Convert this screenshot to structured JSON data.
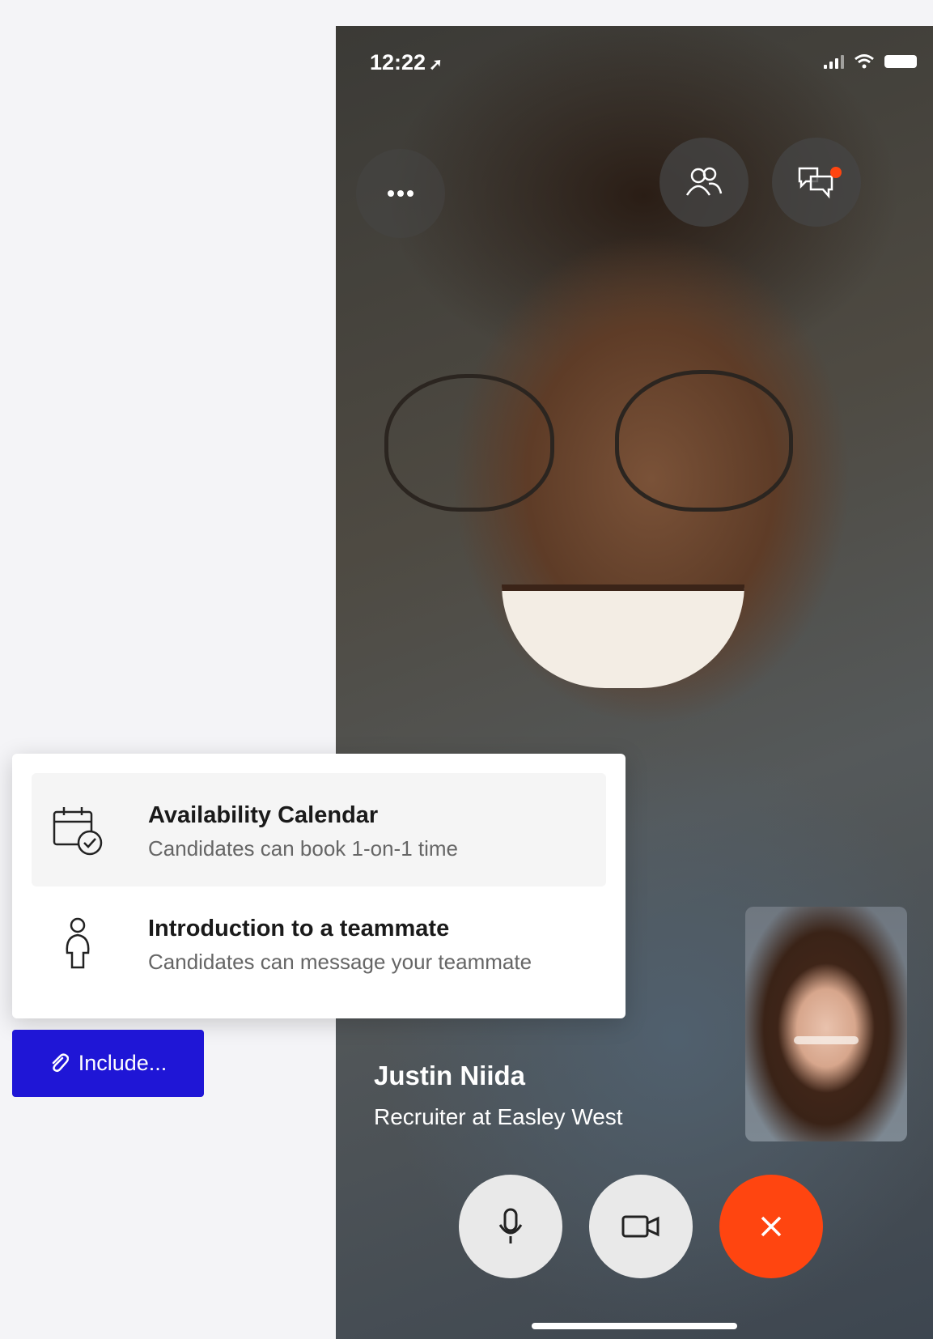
{
  "status_bar": {
    "time": "12:22"
  },
  "call": {
    "caller_name": "Justin Niida",
    "caller_role": "Recruiter at Easley West"
  },
  "include_menu": {
    "items": [
      {
        "title": "Availability Calendar",
        "subtitle": "Candidates can book 1-on-1  time",
        "icon": "calendar-check-icon"
      },
      {
        "title": "Introduction to a teammate",
        "subtitle": "Candidates can message your teammate",
        "icon": "person-icon"
      }
    ]
  },
  "include_button": {
    "label": "Include...",
    "icon": "paperclip-icon"
  },
  "colors": {
    "primary_button": "#1f16d6",
    "end_call": "#ff4510",
    "unread_dot": "#ff4510"
  }
}
